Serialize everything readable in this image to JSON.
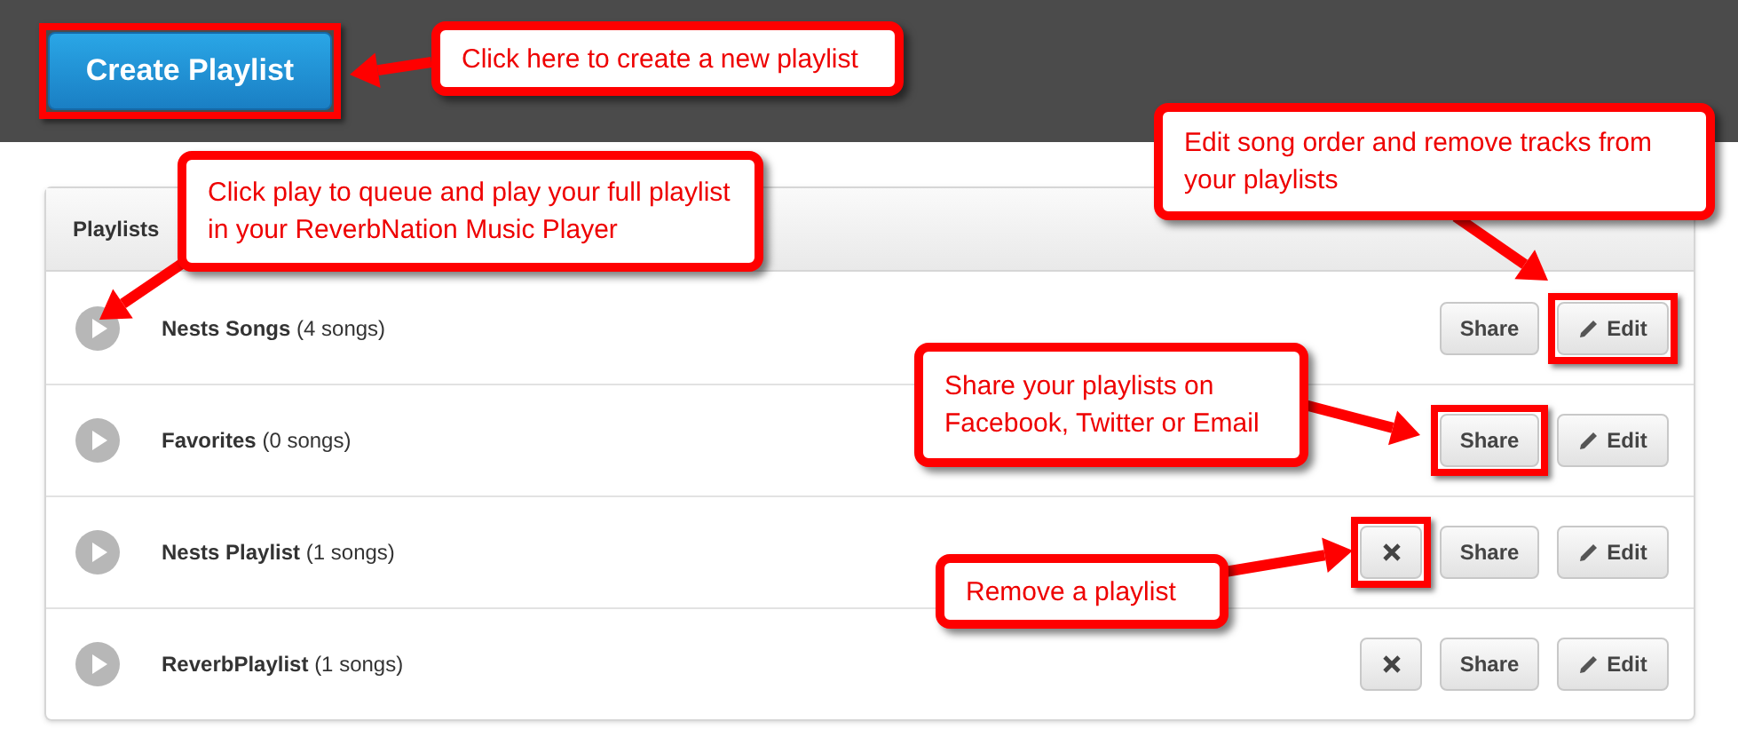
{
  "header": {
    "create_button": {
      "label": "Create Playlist",
      "highlighted": true
    }
  },
  "panel": {
    "title": "Playlists",
    "rows": [
      {
        "name": "Nests Songs",
        "count": "(4 songs)",
        "actions": [
          {
            "kind": "share",
            "label": "Share",
            "highlighted": false
          },
          {
            "kind": "edit",
            "label": "Edit",
            "highlighted": true
          }
        ]
      },
      {
        "name": "Favorites",
        "count": "(0 songs)",
        "actions": [
          {
            "kind": "share",
            "label": "Share",
            "highlighted": true
          },
          {
            "kind": "edit",
            "label": "Edit",
            "highlighted": false
          }
        ]
      },
      {
        "name": "Nests Playlist",
        "count": "(1 songs)",
        "actions": [
          {
            "kind": "remove",
            "highlighted": true
          },
          {
            "kind": "share",
            "label": "Share",
            "highlighted": false
          },
          {
            "kind": "edit",
            "label": "Edit",
            "highlighted": false
          }
        ]
      },
      {
        "name": "ReverbPlaylist",
        "count": "(1 songs)",
        "actions": [
          {
            "kind": "remove",
            "highlighted": false
          },
          {
            "kind": "share",
            "label": "Share",
            "highlighted": false
          },
          {
            "kind": "edit",
            "label": "Edit",
            "highlighted": false
          }
        ]
      }
    ]
  },
  "callouts": [
    {
      "text": "Click here to create a new playlist"
    },
    {
      "text": "Click play to queue and play your full playlist in your ReverbNation Music Player"
    },
    {
      "text": "Edit song order and remove tracks from your playlists"
    },
    {
      "text": "Share your playlists on Facebook, Twitter or Email"
    },
    {
      "text": "Remove a playlist"
    }
  ]
}
